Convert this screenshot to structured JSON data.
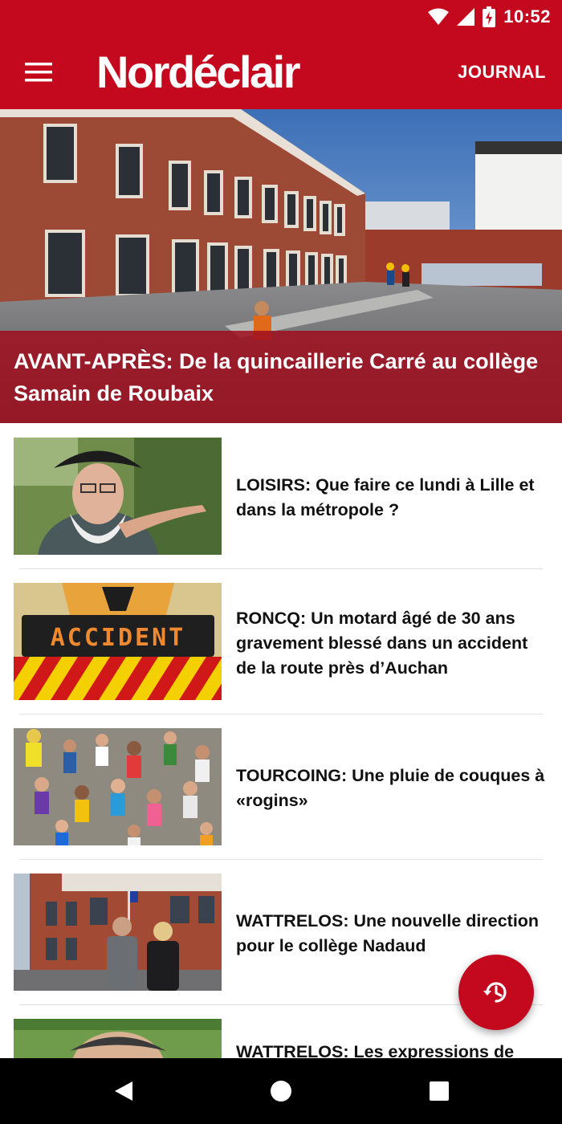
{
  "status_bar": {
    "time": "10:52"
  },
  "app_bar": {
    "logo": "Nordéclair",
    "journal_label": "JOURNAL"
  },
  "hero": {
    "title": "AVANT-APRÈS: De la quincaillerie Carré au collège Samain de Roubaix"
  },
  "articles": [
    {
      "title": "LOISIRS: Que faire ce lundi à Lille et dans la métropole ?"
    },
    {
      "title": "RONCQ: Un motard âgé de 30 ans gravement blessé dans un accident de la route près d’Auchan",
      "sign_text": "ACCIDENT"
    },
    {
      "title": "TOURCOING: Une pluie de couques à «rogins»"
    },
    {
      "title": "WATTRELOS: Une nouvelle direction pour le collège Nadaud"
    },
    {
      "title": "WATTRELOS: Les expressions de"
    }
  ],
  "fab": {
    "icon": "history-icon"
  },
  "colors": {
    "brand": "#c4091f",
    "hero_caption": "#a00e1e"
  }
}
